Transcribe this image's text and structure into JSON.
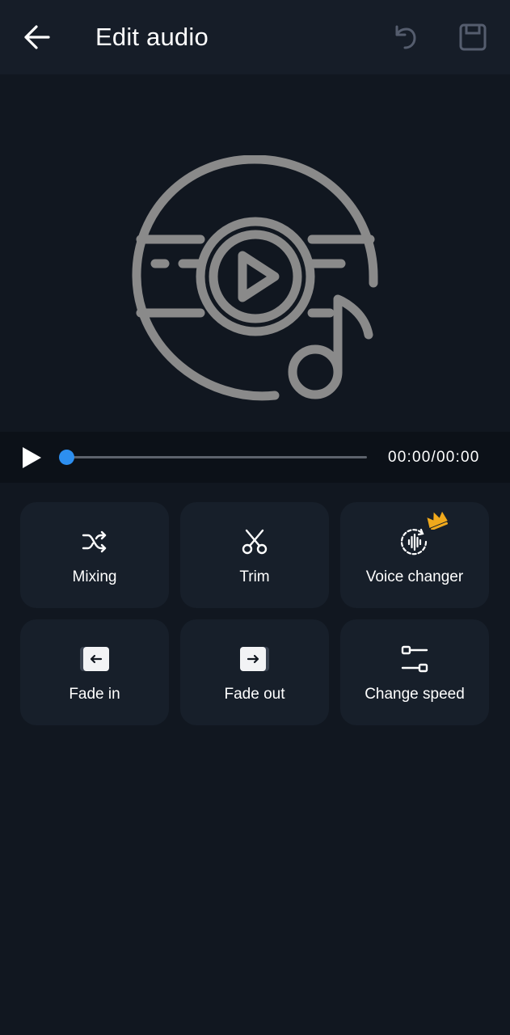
{
  "header": {
    "title": "Edit audio",
    "back_icon": "arrow-left-icon",
    "undo_icon": "undo-icon",
    "save_icon": "save-icon"
  },
  "player": {
    "time": "00:00/00:00",
    "progress": 0,
    "accent_color": "#2d8ff0"
  },
  "tools": [
    {
      "label": "Mixing",
      "icon": "shuffle-icon"
    },
    {
      "label": "Trim",
      "icon": "scissors-icon"
    },
    {
      "label": "Voice changer",
      "icon": "voice-changer-icon",
      "premium": true
    },
    {
      "label": "Fade in",
      "icon": "fade-in-icon"
    },
    {
      "label": "Fade out",
      "icon": "fade-out-icon"
    },
    {
      "label": "Change speed",
      "icon": "change-speed-icon"
    }
  ],
  "colors": {
    "background": "#111720",
    "header": "#161d28",
    "card": "#171f2a",
    "premium": "#f0a91c"
  }
}
